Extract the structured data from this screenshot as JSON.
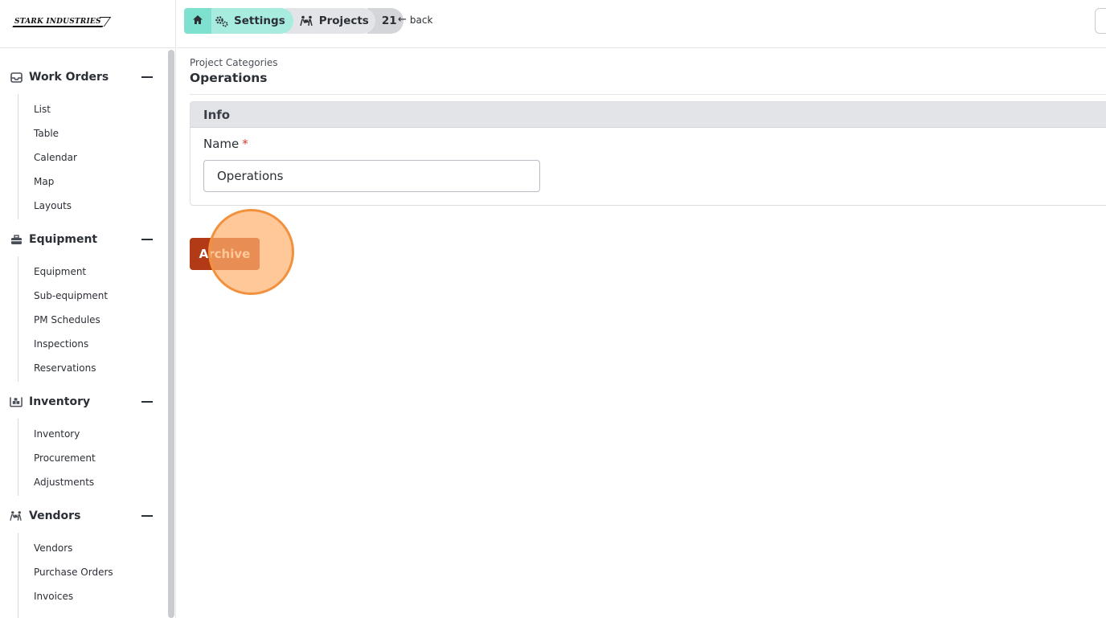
{
  "brand": {
    "logo_text": "STARK INDUSTRIES"
  },
  "sidebar": {
    "sections": [
      {
        "title": "Work Orders",
        "icon": "inbox-icon",
        "items": [
          "List",
          "Table",
          "Calendar",
          "Map",
          "Layouts"
        ]
      },
      {
        "title": "Equipment",
        "icon": "toolbox-icon",
        "items": [
          "Equipment",
          "Sub-equipment",
          "PM Schedules",
          "Inspections",
          "Reservations"
        ]
      },
      {
        "title": "Inventory",
        "icon": "warehouse-icon",
        "items": [
          "Inventory",
          "Procurement",
          "Adjustments"
        ]
      },
      {
        "title": "Vendors",
        "icon": "people-carry-icon",
        "items": [
          "Vendors",
          "Purchase Orders",
          "Invoices"
        ]
      }
    ]
  },
  "topbar": {
    "breadcrumbs": {
      "home_icon": "home-icon",
      "settings": "Settings",
      "projects": "Projects",
      "count": "21"
    },
    "back_label": "back"
  },
  "main": {
    "subtitle": "Project Categories",
    "title": "Operations",
    "card": {
      "header": "Info",
      "name_label": "Name",
      "required_mark": "*",
      "name_value": "Operations"
    },
    "archive_label": "Archive"
  },
  "colors": {
    "accent_teal": "#7ee0cf",
    "archive_button": "#b23a16",
    "required": "#d23b2f",
    "click_highlight": "#f2913d"
  }
}
